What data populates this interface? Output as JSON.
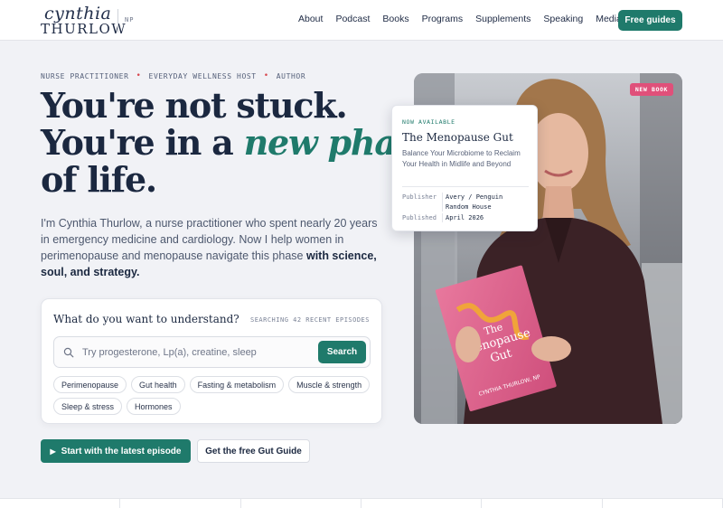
{
  "brand": {
    "script": "cynthia",
    "name": "THURLOW",
    "suffix": "NP"
  },
  "nav": {
    "items": [
      "About",
      "Podcast",
      "Books",
      "Programs",
      "Supplements",
      "Speaking",
      "Media"
    ],
    "cta": "Free guides"
  },
  "hero": {
    "eyebrow": [
      "NURSE PRACTITIONER",
      "EVERYDAY WELLNESS HOST",
      "AUTHOR"
    ],
    "headline_1": "You're not stuck.",
    "headline_2_pre": "You're in a ",
    "headline_2_accent": "new phase",
    "headline_3": "of life.",
    "intro": "I'm Cynthia Thurlow, a nurse practitioner who spent nearly 20 years in emergency medicine and cardiology. Now I help women in perimenopause and menopause navigate this phase ",
    "intro_bold": "with science, soul, and strategy."
  },
  "search": {
    "title": "What do you want to understand?",
    "meta": "SEARCHING 42 RECENT EPISODES",
    "placeholder": "Try progesterone, Lp(a), creatine, sleep",
    "button": "Search",
    "chips": [
      "Perimenopause",
      "Gut health",
      "Fasting & metabolism",
      "Muscle & strength",
      "Sleep & stress",
      "Hormones"
    ]
  },
  "ctas": {
    "primary": "Start with the latest episode",
    "secondary": "Get the free Gut Guide"
  },
  "book": {
    "badge": "NEW BOOK",
    "eyebrow": "NOW AVAILABLE",
    "title": "The Menopause Gut",
    "description": "Balance Your Microbiome to Reclaim Your Health in Midlife and Beyond",
    "publisher_label": "Publisher",
    "publisher": "Avery / Penguin Random House",
    "published_label": "Published",
    "published": "April 2026",
    "cover_title_1": "The",
    "cover_title_2": "Menopause",
    "cover_title_3": "Gut",
    "cover_author": "CYNTHIA THURLOW, NP"
  },
  "colors": {
    "accent": "#1f7a6b",
    "badge": "#e0507a",
    "ink": "#1b2840",
    "background": "#f1f2f6"
  }
}
